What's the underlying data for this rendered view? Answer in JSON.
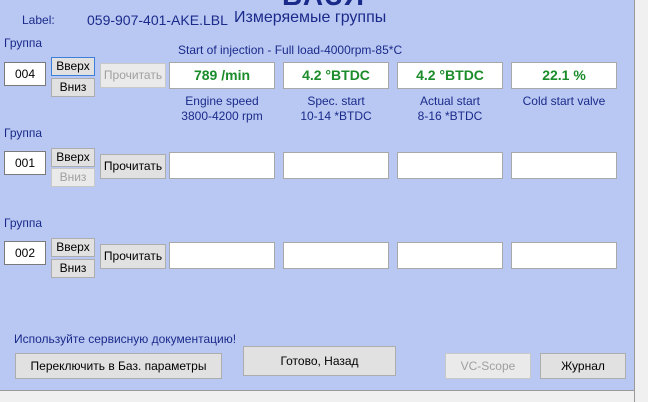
{
  "window": {
    "title_partial": "ВАЗЯ",
    "subtitle": "Измеряемые группы"
  },
  "label": {
    "key": "Label:",
    "value": "059-907-401-AKE.LBL"
  },
  "caption": "Start of injection - Full load-4000rpm-85*C",
  "group_label": "Группа",
  "buttons": {
    "up": "Вверх",
    "down": "Вниз",
    "read": "Прочитать",
    "basic_params": "Переключить в Баз. параметры",
    "done_back": "Готово, Назад",
    "vc_scope": "VC-Scope",
    "log": "Журнал"
  },
  "groups": [
    {
      "number": "004",
      "fields": [
        {
          "value": "789 /min",
          "name": "Engine speed",
          "spec": "3800-4200 rpm"
        },
        {
          "value": "4.2 °BTDC",
          "name": "Spec. start",
          "spec": "10-14 *BTDC"
        },
        {
          "value": "4.2 °BTDC",
          "name": "Actual start",
          "spec": "8-16 *BTDC"
        },
        {
          "value": "22.1 %",
          "name": "Cold start valve",
          "spec": ""
        }
      ]
    },
    {
      "number": "001"
    },
    {
      "number": "002"
    }
  ],
  "note": "Используйте сервисную документацию!",
  "colors": {
    "background": "#b9c8f2",
    "text": "#1a2a8a",
    "value": "#1a8c2a"
  }
}
